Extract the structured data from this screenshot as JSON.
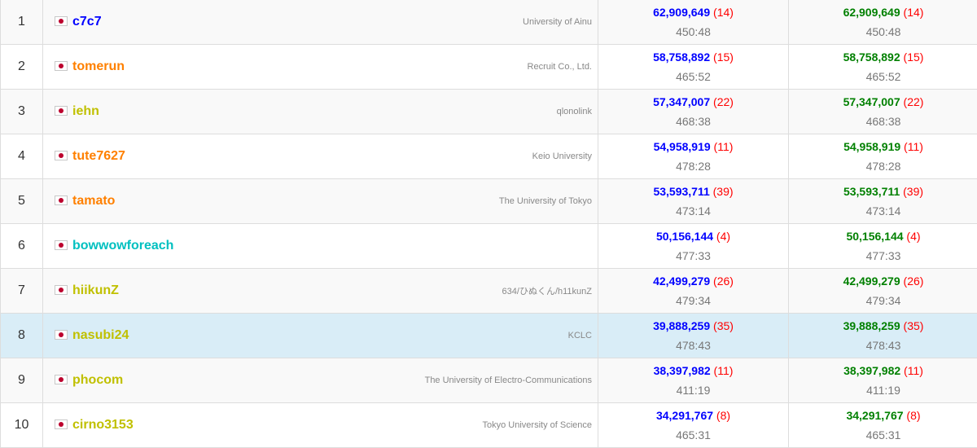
{
  "colors": {
    "rating_blue": "#0000ff",
    "rating_orange": "#ff8000",
    "rating_yellow": "#c0c000",
    "rating_cyan": "#00c0c0",
    "total_score": "#0000ff",
    "task_score": "#008000",
    "penalty": "#ff0000",
    "highlight_row": "#d9edf7"
  },
  "flag_icon": "japan-flag-icon",
  "rows": [
    {
      "rank": "1",
      "user": "c7c7",
      "color": "#0000ff",
      "affiliation": "University of Ainu",
      "score": "62,909,649",
      "penalty": "(14)",
      "time": "450:48",
      "task_score": "62,909,649",
      "task_penalty": "(14)",
      "task_time": "450:48"
    },
    {
      "rank": "2",
      "user": "tomerun",
      "color": "#ff8000",
      "affiliation": "Recruit Co., Ltd.",
      "score": "58,758,892",
      "penalty": "(15)",
      "time": "465:52",
      "task_score": "58,758,892",
      "task_penalty": "(15)",
      "task_time": "465:52"
    },
    {
      "rank": "3",
      "user": "iehn",
      "color": "#c0c000",
      "affiliation": "qlonolink",
      "score": "57,347,007",
      "penalty": "(22)",
      "time": "468:38",
      "task_score": "57,347,007",
      "task_penalty": "(22)",
      "task_time": "468:38"
    },
    {
      "rank": "4",
      "user": "tute7627",
      "color": "#ff8000",
      "affiliation": "Keio University",
      "score": "54,958,919",
      "penalty": "(11)",
      "time": "478:28",
      "task_score": "54,958,919",
      "task_penalty": "(11)",
      "task_time": "478:28"
    },
    {
      "rank": "5",
      "user": "tamato",
      "color": "#ff8000",
      "affiliation": "The University of Tokyo",
      "score": "53,593,711",
      "penalty": "(39)",
      "time": "473:14",
      "task_score": "53,593,711",
      "task_penalty": "(39)",
      "task_time": "473:14"
    },
    {
      "rank": "6",
      "user": "bowwowforeach",
      "color": "#00c0c0",
      "affiliation": "",
      "score": "50,156,144",
      "penalty": "(4)",
      "time": "477:33",
      "task_score": "50,156,144",
      "task_penalty": "(4)",
      "task_time": "477:33"
    },
    {
      "rank": "7",
      "user": "hiikunZ",
      "color": "#c0c000",
      "affiliation": "634/ひぬくん/h11kunZ",
      "score": "42,499,279",
      "penalty": "(26)",
      "time": "479:34",
      "task_score": "42,499,279",
      "task_penalty": "(26)",
      "task_time": "479:34"
    },
    {
      "rank": "8",
      "user": "nasubi24",
      "color": "#c0c000",
      "affiliation": "KCLC",
      "score": "39,888,259",
      "penalty": "(35)",
      "time": "478:43",
      "task_score": "39,888,259",
      "task_penalty": "(35)",
      "task_time": "478:43",
      "highlight": true
    },
    {
      "rank": "9",
      "user": "phocom",
      "color": "#c0c000",
      "affiliation": "The University of Electro-Communications",
      "score": "38,397,982",
      "penalty": "(11)",
      "time": "411:19",
      "task_score": "38,397,982",
      "task_penalty": "(11)",
      "task_time": "411:19"
    },
    {
      "rank": "10",
      "user": "cirno3153",
      "color": "#c0c000",
      "affiliation": "Tokyo University of Science",
      "score": "34,291,767",
      "penalty": "(8)",
      "time": "465:31",
      "task_score": "34,291,767",
      "task_penalty": "(8)",
      "task_time": "465:31"
    }
  ]
}
